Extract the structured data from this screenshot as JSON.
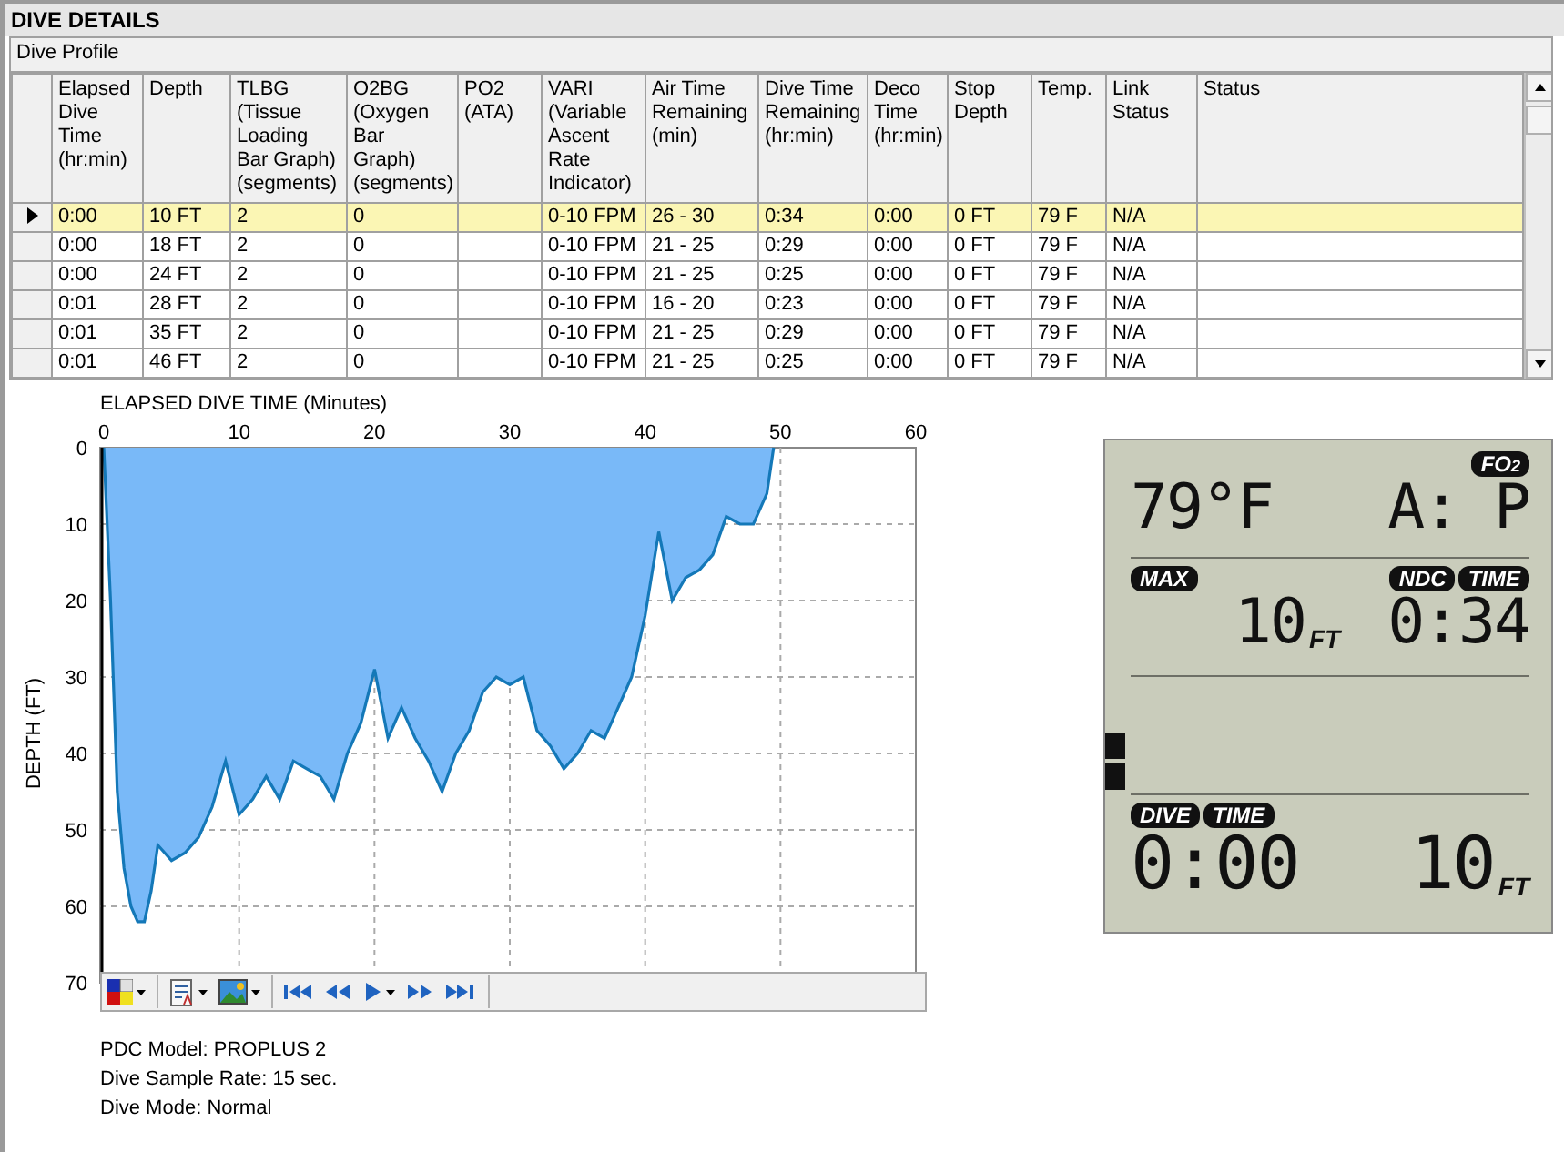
{
  "panel": {
    "title": "DIVE DETAILS"
  },
  "profile": {
    "title": "Dive Profile",
    "columns": [
      "Elapsed Dive Time (hr:min)",
      "Depth",
      "TLBG (Tissue Loading Bar Graph) (segments)",
      "O2BG (Oxygen Bar Graph) (segments)",
      "PO2 (ATA)",
      "VARI (Variable Ascent Rate Indicator)",
      "Air Time Remaining (min)",
      "Dive Time Remaining (hr:min)",
      "Deco Time (hr:min)",
      "Stop Depth",
      "Temp.",
      "Link Status",
      "Status"
    ],
    "rows": [
      {
        "selected": true,
        "cells": [
          "0:00",
          "10 FT",
          "2",
          "0",
          null,
          "0-10 FPM",
          "26 - 30",
          "0:34",
          "0:00",
          "0 FT",
          "79 F",
          "N/A",
          null
        ]
      },
      {
        "selected": false,
        "cells": [
          "0:00",
          "18 FT",
          "2",
          "0",
          null,
          "0-10 FPM",
          "21 - 25",
          "0:29",
          "0:00",
          "0 FT",
          "79 F",
          "N/A",
          null
        ]
      },
      {
        "selected": false,
        "cells": [
          "0:00",
          "24 FT",
          "2",
          "0",
          null,
          "0-10 FPM",
          "21 - 25",
          "0:25",
          "0:00",
          "0 FT",
          "79 F",
          "N/A",
          null
        ]
      },
      {
        "selected": false,
        "cells": [
          "0:01",
          "28 FT",
          "2",
          "0",
          null,
          "0-10 FPM",
          "16 - 20",
          "0:23",
          "0:00",
          "0 FT",
          "79 F",
          "N/A",
          null
        ]
      },
      {
        "selected": false,
        "cells": [
          "0:01",
          "35 FT",
          "2",
          "0",
          null,
          "0-10 FPM",
          "21 - 25",
          "0:29",
          "0:00",
          "0 FT",
          "79 F",
          "N/A",
          null
        ]
      },
      {
        "selected": false,
        "cells": [
          "0:01",
          "46 FT",
          "2",
          "0",
          null,
          "0-10 FPM",
          "21 - 25",
          "0:25",
          "0:00",
          "0 FT",
          "79 F",
          "N/A",
          null
        ]
      }
    ]
  },
  "chart": {
    "chart_data": {
      "type": "area",
      "xlabel": "ELAPSED DIVE TIME (Minutes)",
      "ylabel": "DEPTH (FT)",
      "x": [
        0,
        0.5,
        1,
        1.5,
        2,
        2.5,
        3,
        3.5,
        4,
        5,
        6,
        7,
        8,
        9,
        10,
        11,
        12,
        13,
        14,
        15,
        16,
        17,
        18,
        19,
        20,
        21,
        22,
        23,
        24,
        25,
        26,
        27,
        28,
        29,
        30,
        31,
        32,
        33,
        34,
        35,
        36,
        37,
        38,
        39,
        40,
        41,
        42,
        43,
        44,
        45,
        46,
        47,
        48,
        49,
        49.5
      ],
      "series": [
        {
          "color": "#79b9f8",
          "values": [
            0,
            20,
            45,
            55,
            60,
            62,
            62,
            58,
            52,
            54,
            53,
            51,
            47,
            41,
            48,
            46,
            43,
            46,
            41,
            42,
            43,
            46,
            40,
            36,
            29,
            38,
            34,
            38,
            41,
            45,
            40,
            37,
            32,
            30,
            31,
            30,
            37,
            39,
            42,
            40,
            37,
            38,
            34,
            30,
            22,
            11,
            20,
            17,
            16,
            14,
            9,
            10,
            10,
            6,
            0
          ]
        }
      ],
      "grid": true,
      "xlim": [
        0,
        60
      ],
      "ylim": [
        70,
        0
      ],
      "xticks": [
        0,
        10,
        20,
        30,
        40,
        50,
        60
      ],
      "yticks": [
        0,
        10,
        20,
        30,
        40,
        50,
        60,
        70
      ]
    }
  },
  "info": [
    "PDC Model: PROPLUS 2",
    "Dive Sample Rate: 15 sec.",
    "Dive Mode: Normal"
  ],
  "display": {
    "fo2_badge": "FO$_{2}$",
    "temperature": "79°F",
    "fo2": "A: P",
    "max_badge": "MAX",
    "max_depth": "10",
    "max_unit": "FT",
    "ndc_badges": [
      "NDC",
      "TIME"
    ],
    "ndc_time": "0:34",
    "dive_badges": [
      "DIVE",
      "TIME"
    ],
    "dive_time": "0:00",
    "depth": "10",
    "depth_unit": "FT"
  }
}
